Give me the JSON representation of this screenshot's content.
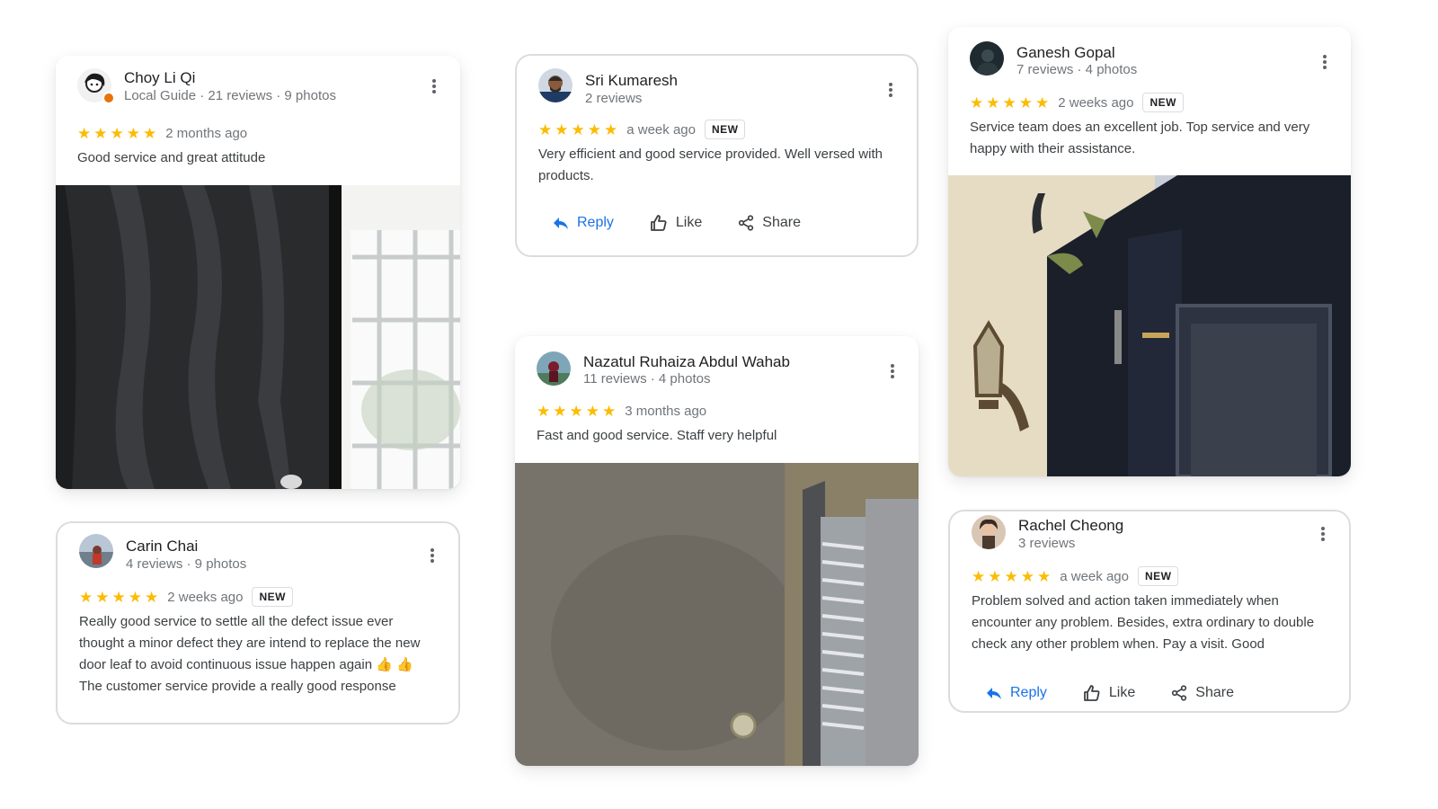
{
  "colors": {
    "star": "#fbbc04",
    "link": "#1a73e8",
    "meta": "#70757a"
  },
  "reviews": [
    {
      "name": "Choy Li Qi",
      "meta": "Local Guide · 21 reviews · 9 photos",
      "rating": 5,
      "age": "2 months ago",
      "is_new": false,
      "text": "Good service and great attitude",
      "has_photo": true
    },
    {
      "name": "Carin Chai",
      "meta": "4 reviews · 9 photos",
      "rating": 5,
      "age": "2 weeks ago",
      "is_new": true,
      "new_label": "NEW",
      "text": "Really good service to settle all the defect issue ever thought a minor defect they are intend to replace the new door leaf to avoid continuous issue happen again 👍 👍 The customer service provide a really good response"
    },
    {
      "name": "Sri Kumaresh",
      "meta": "2 reviews",
      "rating": 5,
      "age": "a week ago",
      "is_new": true,
      "new_label": "NEW",
      "text": "Very efficient and good service provided. Well versed with products."
    },
    {
      "name": "Nazatul Ruhaiza Abdul Wahab",
      "meta": "11 reviews · 4 photos",
      "rating": 5,
      "age": "3 months ago",
      "is_new": false,
      "text": "Fast and good service. Staff very helpful",
      "has_photo": true
    },
    {
      "name": "Ganesh Gopal",
      "meta": "7 reviews · 4 photos",
      "rating": 5,
      "age": "2 weeks ago",
      "is_new": true,
      "new_label": "NEW",
      "text": "Service team does an excellent job. Top service and very happy with their assistance.",
      "has_photo": true
    },
    {
      "name": "Rachel Cheong",
      "meta": "3 reviews",
      "rating": 5,
      "age": "a week ago",
      "is_new": true,
      "new_label": "NEW",
      "text": "Problem solved and action taken immediately when encounter any problem. Besides, extra ordinary to double check any other problem when. Pay a visit. Good"
    }
  ],
  "actions": {
    "reply": "Reply",
    "like": "Like",
    "share": "Share"
  },
  "icons": {
    "star": "star-icon",
    "reply": "reply-arrow-icon",
    "like": "thumbs-up-icon",
    "share": "share-icon",
    "more": "more-vert-icon"
  }
}
